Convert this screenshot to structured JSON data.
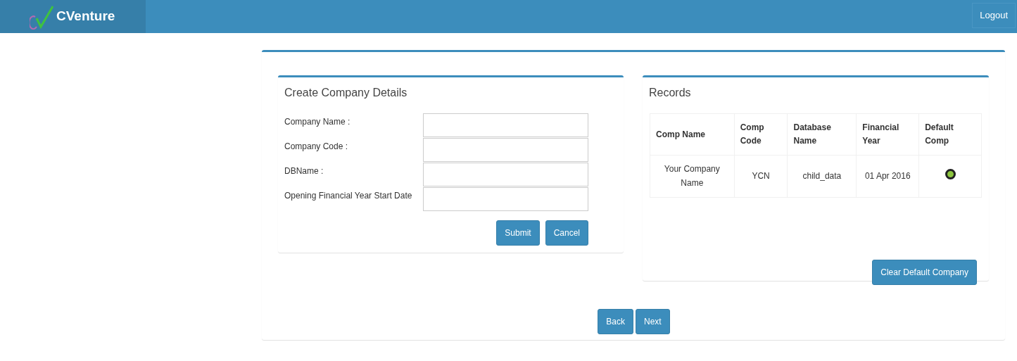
{
  "header": {
    "brand": "CVenture",
    "logout": "Logout"
  },
  "form": {
    "title": "Create Company Details",
    "fields": [
      {
        "label": "Company Name :"
      },
      {
        "label": "Company Code :"
      },
      {
        "label": "DBName :"
      },
      {
        "label": "Opening Financial Year Start Date"
      }
    ],
    "buttons": [
      "Submit",
      "Cancel"
    ]
  },
  "records": {
    "title": "Records",
    "columns": [
      "Comp Name",
      "Comp Code",
      "Database Name",
      "Financial Year",
      "Default Comp"
    ],
    "rows": [
      {
        "cells": [
          "Your Company Name",
          "YCN",
          "child_data",
          "01 Apr 2016"
        ],
        "selected": true
      }
    ],
    "button": "Clear Default Company"
  },
  "nav_buttons": [
    "Back",
    "Next"
  ]
}
